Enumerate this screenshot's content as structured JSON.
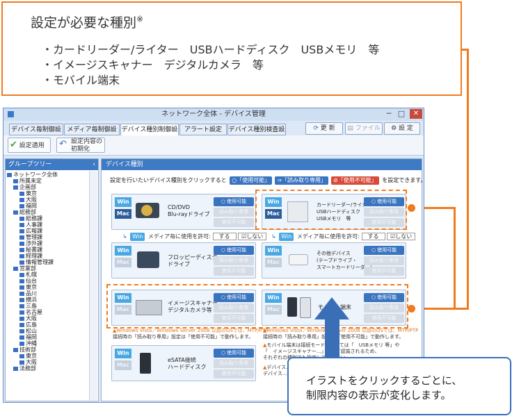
{
  "callout": {
    "title": "設定が必要な種別",
    "title_mark": "※",
    "lines": [
      "・カードリーダー/ライター　USBハードディスク　USBメモリ　等",
      "・イメージスキャナー　デジタルカメラ　等",
      "・モバイル端末"
    ]
  },
  "window": {
    "title": "ネットワーク全体 - デバイス管理",
    "close": "✕",
    "minimize": "─",
    "maximize": "□"
  },
  "tabs": [
    "デバイス毎制御設定",
    "メディア毎制御設定",
    "デバイス種別制御設定",
    "アラート設定",
    "デバイス種別検査設定"
  ],
  "tab_buttons": {
    "update": "更 新",
    "file": "ファイル",
    "settings": "設 定"
  },
  "toolbar": {
    "apply": "設定適用",
    "reset": "設定内容の\n初期化"
  },
  "tree": {
    "header": "グループツリー",
    "items": [
      {
        "label": "ネットワーク全体",
        "indent": 0
      },
      {
        "label": "所属未定",
        "indent": 1
      },
      {
        "label": "企画部",
        "indent": 1
      },
      {
        "label": "東京",
        "indent": 2
      },
      {
        "label": "大阪",
        "indent": 2
      },
      {
        "label": "福岡",
        "indent": 2
      },
      {
        "label": "総務部",
        "indent": 1
      },
      {
        "label": "総務課",
        "indent": 2
      },
      {
        "label": "人事課",
        "indent": 2
      },
      {
        "label": "広報課",
        "indent": 2
      },
      {
        "label": "管理課",
        "indent": 2
      },
      {
        "label": "渉外課",
        "indent": 2
      },
      {
        "label": "秘書課",
        "indent": 2
      },
      {
        "label": "経理課",
        "indent": 2
      },
      {
        "label": "情報管理課",
        "indent": 2
      },
      {
        "label": "営業部",
        "indent": 1
      },
      {
        "label": "札幌",
        "indent": 2
      },
      {
        "label": "仙台",
        "indent": 2
      },
      {
        "label": "東京",
        "indent": 2
      },
      {
        "label": "品川",
        "indent": 2
      },
      {
        "label": "横浜",
        "indent": 2
      },
      {
        "label": "三島",
        "indent": 2
      },
      {
        "label": "名古屋",
        "indent": 2
      },
      {
        "label": "大阪",
        "indent": 2
      },
      {
        "label": "広島",
        "indent": 2
      },
      {
        "label": "松山",
        "indent": 2
      },
      {
        "label": "福岡",
        "indent": 2
      },
      {
        "label": "沖縄",
        "indent": 2
      },
      {
        "label": "技術部",
        "indent": 1
      },
      {
        "label": "東京",
        "indent": 2
      },
      {
        "label": "大阪",
        "indent": 2
      },
      {
        "label": "法務部",
        "indent": 1
      }
    ]
  },
  "main": {
    "header": "デバイス種別",
    "instr_pre": "設定を行いたいデバイス種別をクリックすると",
    "chip_allow": "「使用可能」",
    "chip_ro": "「読み取り専用」",
    "chip_deny": "「使用不可能」",
    "instr_post": "を設定できます。",
    "win": "Win",
    "mac": "Mac",
    "status_allow": "使用可能",
    "status_ro": "読み取り専用",
    "status_deny": "使用不可能",
    "media_label": "メディア毎に使用を許可:",
    "media_yes": "する",
    "media_no": "しない",
    "cards": {
      "cd": "CD/DVD\nBlu-rayドライブ",
      "card": "カードリーダー/ライター\nUSBハードディスク\nUSBメモリ　等",
      "floppy": "フロッピーディスク\nドライブ",
      "other": "その他デバイス\n(テープドライブ・\nスマートカードリーダー)",
      "scanner": "イメージスキャナー\nデジタルカメラ等",
      "mobile": "モバイル端末",
      "esata": "eSATA接続\nハードディスク"
    },
    "note_vista": "Windows Vista／Windows Server 2008 以前のOSでは、MTP/PTP",
    "note_vista2": "接続時の「読み取り専用」設定は「使用不可能」で動作します。",
    "note_mobile1": "モバイル端末は接続モードによっては「　USBメモリ 等」や",
    "note_mobile2": "「　イメージスキャナー…」として認識されるため、",
    "note_mobile3": "それぞれの種別でも設定してください。",
    "note_device": "デバイス…",
    "note_device2": "デバイス…"
  },
  "callout2": {
    "text": "イラストをクリックするごとに、\n制限内容の表示が変化します。"
  }
}
